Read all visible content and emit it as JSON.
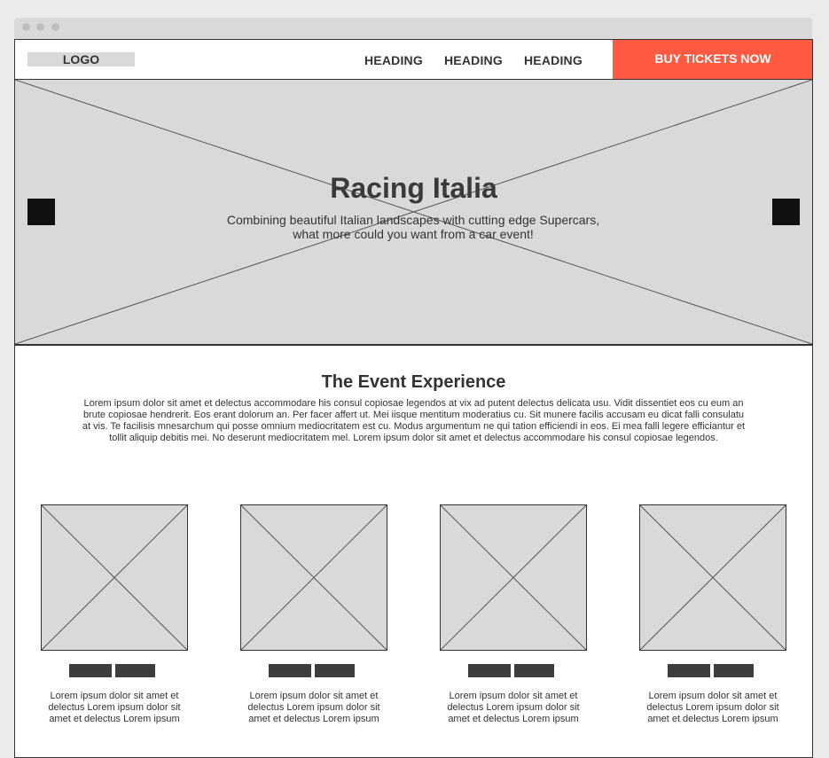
{
  "navbar": {
    "logo": "LOGO",
    "links": [
      "HEADING",
      "HEADING",
      "HEADING"
    ],
    "cta": "BUY TICKETS NOW",
    "cta_color": "#fd5a41"
  },
  "hero": {
    "title": "Racing Italia",
    "subtitle": "Combining beautiful Italian landscapes with cutting edge Supercars, what more could you want from a car event!",
    "prev_icon": "square-prev-icon",
    "next_icon": "square-next-icon"
  },
  "experience": {
    "title": "The Event Experience",
    "body": "Lorem ipsum dolor sit amet et delectus accommodare his consul copiosae legendos at vix ad putent delectus delicata usu. Vidit dissentiet eos cu eum an brute copiosae hendrerit. Eos erant dolorum an. Per facer affert ut. Mei iisque mentitum moderatius cu. Sit munere facilis accusam eu dicat falli consulatu at vis. Te facilisis mnesarchum qui posse omnium mediocritatem est cu. Modus argumentum ne qui tation efficiendi in eos. Ei mea falli legere efficiantur et tollit aliquip debitis mei. No deserunt mediocritatem mel. Lorem ipsum dolor sit amet et delectus accommodare his consul copiosae legendos."
  },
  "cards": [
    {
      "text": "Lorem ipsum dolor sit amet et delectus Lorem ipsum dolor sit amet et delectus Lorem ipsum"
    },
    {
      "text": "Lorem ipsum dolor sit amet et delectus Lorem ipsum dolor sit amet et delectus Lorem ipsum"
    },
    {
      "text": "Lorem ipsum dolor sit amet et delectus Lorem ipsum dolor sit amet et delectus Lorem ipsum"
    },
    {
      "text": "Lorem ipsum dolor sit amet et delectus Lorem ipsum dolor sit amet et delectus Lorem ipsum"
    }
  ]
}
